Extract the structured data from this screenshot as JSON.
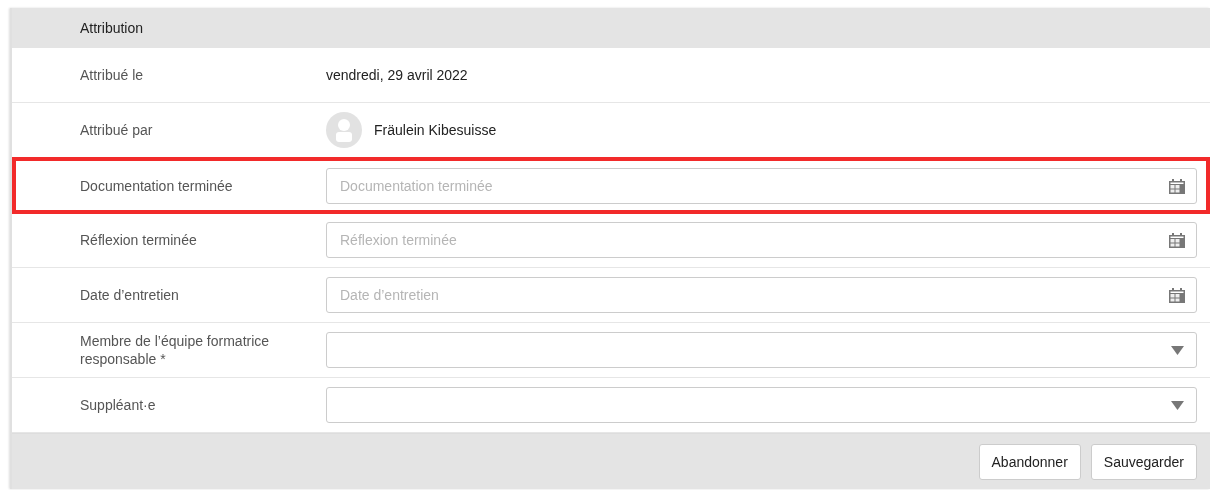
{
  "section": {
    "title": "Attribution"
  },
  "rows": [
    {
      "kind": "text",
      "label": "Attribué le",
      "value": "vendredi, 29 avril 2022",
      "highlighted": false
    },
    {
      "kind": "user",
      "label": "Attribué par",
      "value": "Fräulein Kibesuisse",
      "highlighted": false
    },
    {
      "kind": "date",
      "label": "Documentation terminée",
      "placeholder": "Documentation terminée",
      "highlighted": true
    },
    {
      "kind": "date",
      "label": "Réflexion terminée",
      "placeholder": "Réflexion terminée",
      "highlighted": false
    },
    {
      "kind": "date",
      "label": "Date d’entretien",
      "placeholder": "Date d’entretien",
      "highlighted": false
    },
    {
      "kind": "select",
      "label": "Membre de l’équipe formatrice responsable *",
      "highlighted": false
    },
    {
      "kind": "select",
      "label": "Suppléant·e",
      "highlighted": false
    }
  ],
  "buttons": [
    "Abandonner",
    "Sauvegarder"
  ]
}
